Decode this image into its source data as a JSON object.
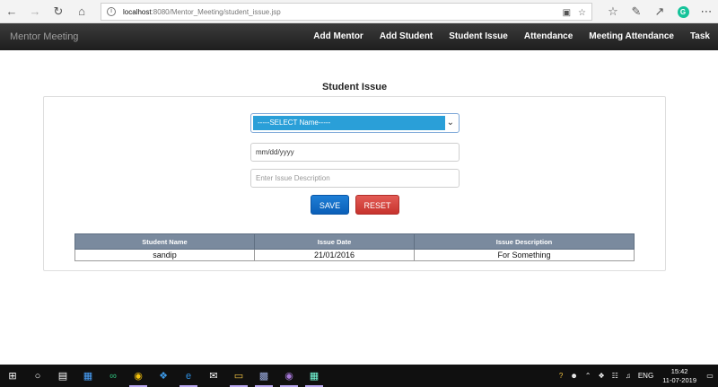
{
  "browser": {
    "url_host": "localhost",
    "url_path": ":8080/Mentor_Meeting/student_issue.jsp"
  },
  "navbar": {
    "brand": "Mentor Meeting",
    "items": [
      "Add Mentor",
      "Add Student",
      "Student Issue",
      "Attendance",
      "Meeting Attendance",
      "Task"
    ]
  },
  "form": {
    "title": "Student Issue",
    "select_value": "-----SELECT Name-----",
    "date_value": "mm/dd/yyyy",
    "description_placeholder": "Enter Issue Description",
    "save_label": "SAVE",
    "reset_label": "RESET"
  },
  "table": {
    "columns": [
      "Student Name",
      "Issue Date",
      "Issue Description"
    ],
    "rows": [
      [
        "sandip",
        "21/01/2016",
        "For Something"
      ]
    ]
  },
  "taskbar": {
    "language": "ENG",
    "time": "15:42",
    "date": "11-07-2019"
  },
  "colors": {
    "navbar": "#222222",
    "select_highlight": "#2a9fd8",
    "save": "#0b5fb8",
    "reset": "#c7332d",
    "table_header": "#7a8a9e"
  }
}
